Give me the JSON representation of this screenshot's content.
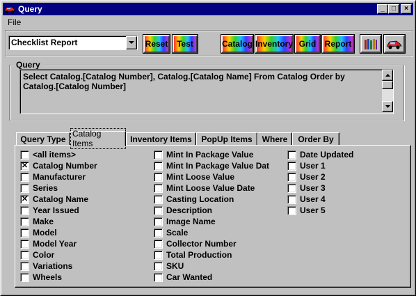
{
  "window": {
    "title": "Query",
    "controls": {
      "minimize": "_",
      "maximize": "□",
      "close": "×"
    }
  },
  "menu": {
    "items": [
      "File"
    ]
  },
  "toolbar": {
    "report_select": {
      "value": "Checklist Report"
    },
    "buttons": [
      {
        "label": "Reset"
      },
      {
        "label": "Test"
      },
      {
        "label": "Catalog"
      },
      {
        "label": "Inventory"
      },
      {
        "label": "Grid"
      },
      {
        "label": "Report"
      }
    ],
    "icon_buttons": [
      {
        "icon": "books-icon"
      },
      {
        "icon": "car-icon"
      }
    ]
  },
  "query": {
    "label": "Query",
    "text": "Select Catalog.[Catalog Number], Catalog.[Catalog Name] From Catalog Order by Catalog.[Catalog Number]"
  },
  "tabs": [
    {
      "label": "Query Type",
      "active": false
    },
    {
      "label": "Catalog Items",
      "active": true
    },
    {
      "label": "Inventory Items",
      "active": false
    },
    {
      "label": "PopUp Items",
      "active": false
    },
    {
      "label": "Where",
      "active": false
    },
    {
      "label": "Order By",
      "active": false
    }
  ],
  "catalog_items": {
    "columns": [
      [
        {
          "label": "<all items>",
          "checked": false
        },
        {
          "label": "Catalog Number",
          "checked": true
        },
        {
          "label": "Manufacturer",
          "checked": false
        },
        {
          "label": "Series",
          "checked": false
        },
        {
          "label": "Catalog Name",
          "checked": true
        },
        {
          "label": "Year Issued",
          "checked": false
        },
        {
          "label": "Make",
          "checked": false
        },
        {
          "label": "Model",
          "checked": false
        },
        {
          "label": "Model Year",
          "checked": false
        },
        {
          "label": "Color",
          "checked": false
        },
        {
          "label": "Variations",
          "checked": false
        },
        {
          "label": "Wheels",
          "checked": false
        }
      ],
      [
        {
          "label": "Mint In Package Value",
          "checked": false
        },
        {
          "label": "Mint In Package Value Dat",
          "checked": false
        },
        {
          "label": "Mint Loose Value",
          "checked": false
        },
        {
          "label": "Mint Loose Value Date",
          "checked": false
        },
        {
          "label": "Casting Location",
          "checked": false
        },
        {
          "label": "Description",
          "checked": false
        },
        {
          "label": "Image Name",
          "checked": false
        },
        {
          "label": "Scale",
          "checked": false
        },
        {
          "label": "Collector Number",
          "checked": false
        },
        {
          "label": "Total Production",
          "checked": false
        },
        {
          "label": "SKU",
          "checked": false
        },
        {
          "label": "Car Wanted",
          "checked": false
        }
      ],
      [
        {
          "label": "Date Updated",
          "checked": false
        },
        {
          "label": "User 1",
          "checked": false
        },
        {
          "label": "User 2",
          "checked": false
        },
        {
          "label": "User 3",
          "checked": false
        },
        {
          "label": "User 4",
          "checked": false
        },
        {
          "label": "User 5",
          "checked": false
        }
      ]
    ]
  }
}
